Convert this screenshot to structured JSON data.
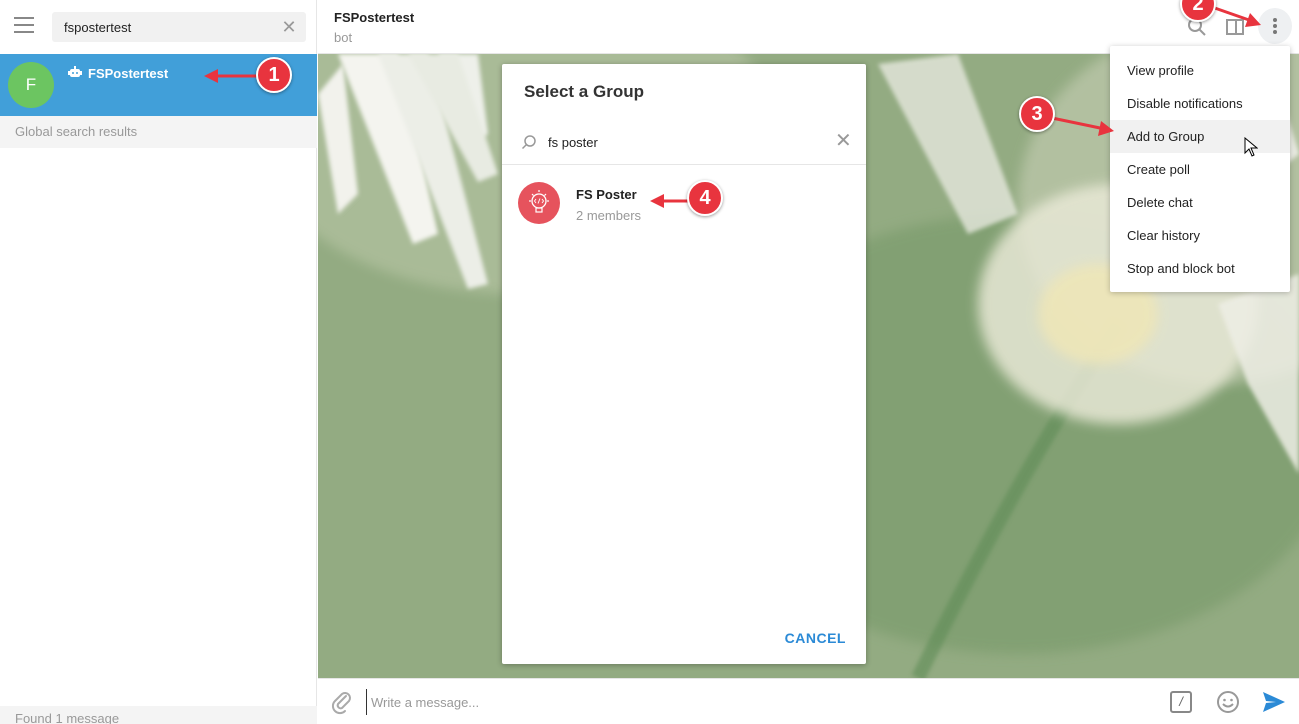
{
  "sidebar": {
    "search_value": "fspostertest",
    "search_clear": "✕",
    "chat_item": {
      "avatar_letter": "F",
      "name": "FSPostertest"
    },
    "global_search_header": "Global search results",
    "found_text": "Found 1 message"
  },
  "header": {
    "peer_name": "FSPostertest",
    "peer_status": "bot"
  },
  "composer": {
    "placeholder": "Write a message...",
    "command_glyph": "/"
  },
  "modal": {
    "title": "Select a Group",
    "search_value": "fs poster",
    "clear": "✕",
    "groups": [
      {
        "name": "FS Poster",
        "members": "2 members"
      }
    ],
    "cancel_label": "CANCEL"
  },
  "dropdown": {
    "items": [
      "View profile",
      "Disable notifications",
      "Add to Group",
      "Create poll",
      "Delete chat",
      "Clear history",
      "Stop and block bot"
    ],
    "hovered_index": 2
  },
  "annotations": [
    "1",
    "2",
    "3",
    "4"
  ],
  "colors": {
    "accent": "#419fd9",
    "avatar_green": "#6cc561",
    "group_avatar": "#e6535d",
    "badge_red": "#e8343e",
    "link_blue": "#2b8ad6"
  }
}
